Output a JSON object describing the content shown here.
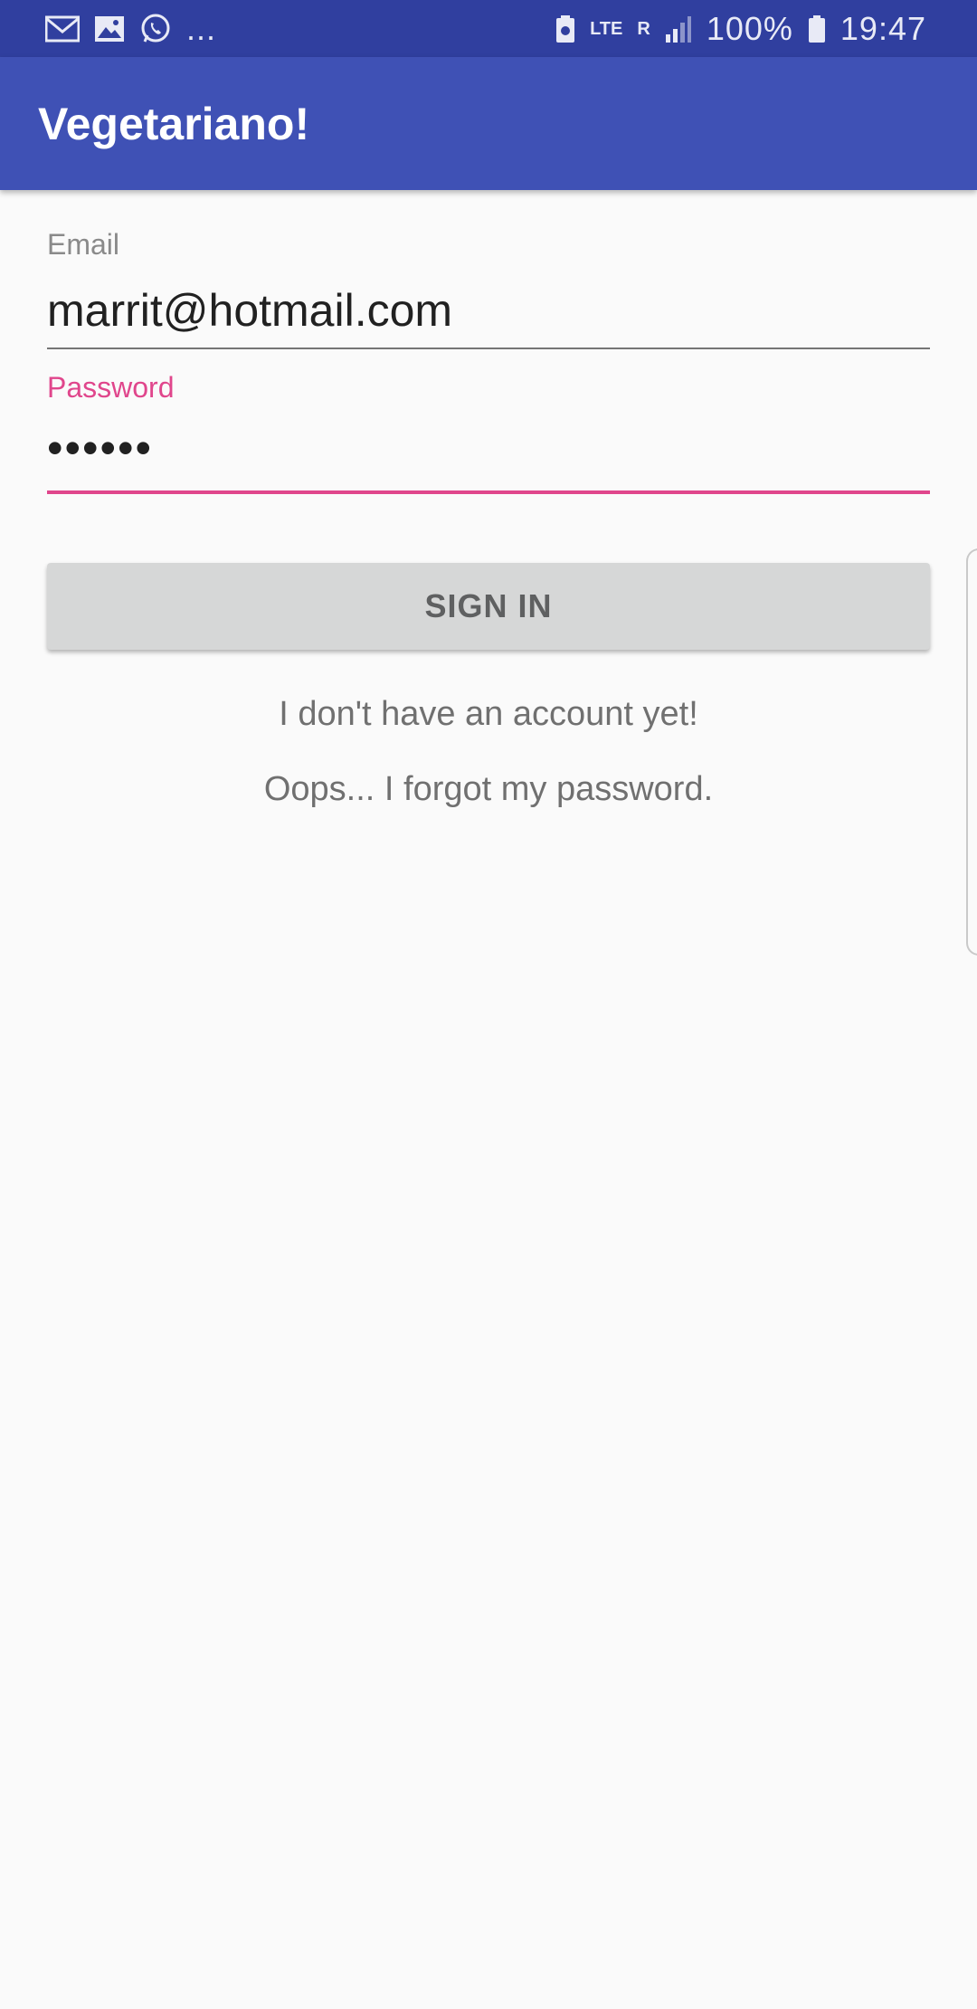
{
  "status_bar": {
    "left_icons": [
      "gmail-icon",
      "gallery-icon",
      "whatsapp-icon"
    ],
    "overflow": "...",
    "network_type": "LTE",
    "roaming": "R",
    "battery_percent": "100%",
    "time": "19:47"
  },
  "app_bar": {
    "title": "Vegetariano!"
  },
  "form": {
    "email": {
      "label": "Email",
      "value": "marrit@hotmail.com"
    },
    "password": {
      "label": "Password",
      "value": "••••••"
    },
    "sign_in_label": "SIGN IN",
    "no_account_link": "I don't have an account yet!",
    "forgot_password_link": "Oops... I forgot my password."
  },
  "colors": {
    "status_bar": "#303f9f",
    "app_bar": "#3f51b5",
    "accent": "#e0468c",
    "background": "#fafafa",
    "button": "#d6d7d7"
  }
}
